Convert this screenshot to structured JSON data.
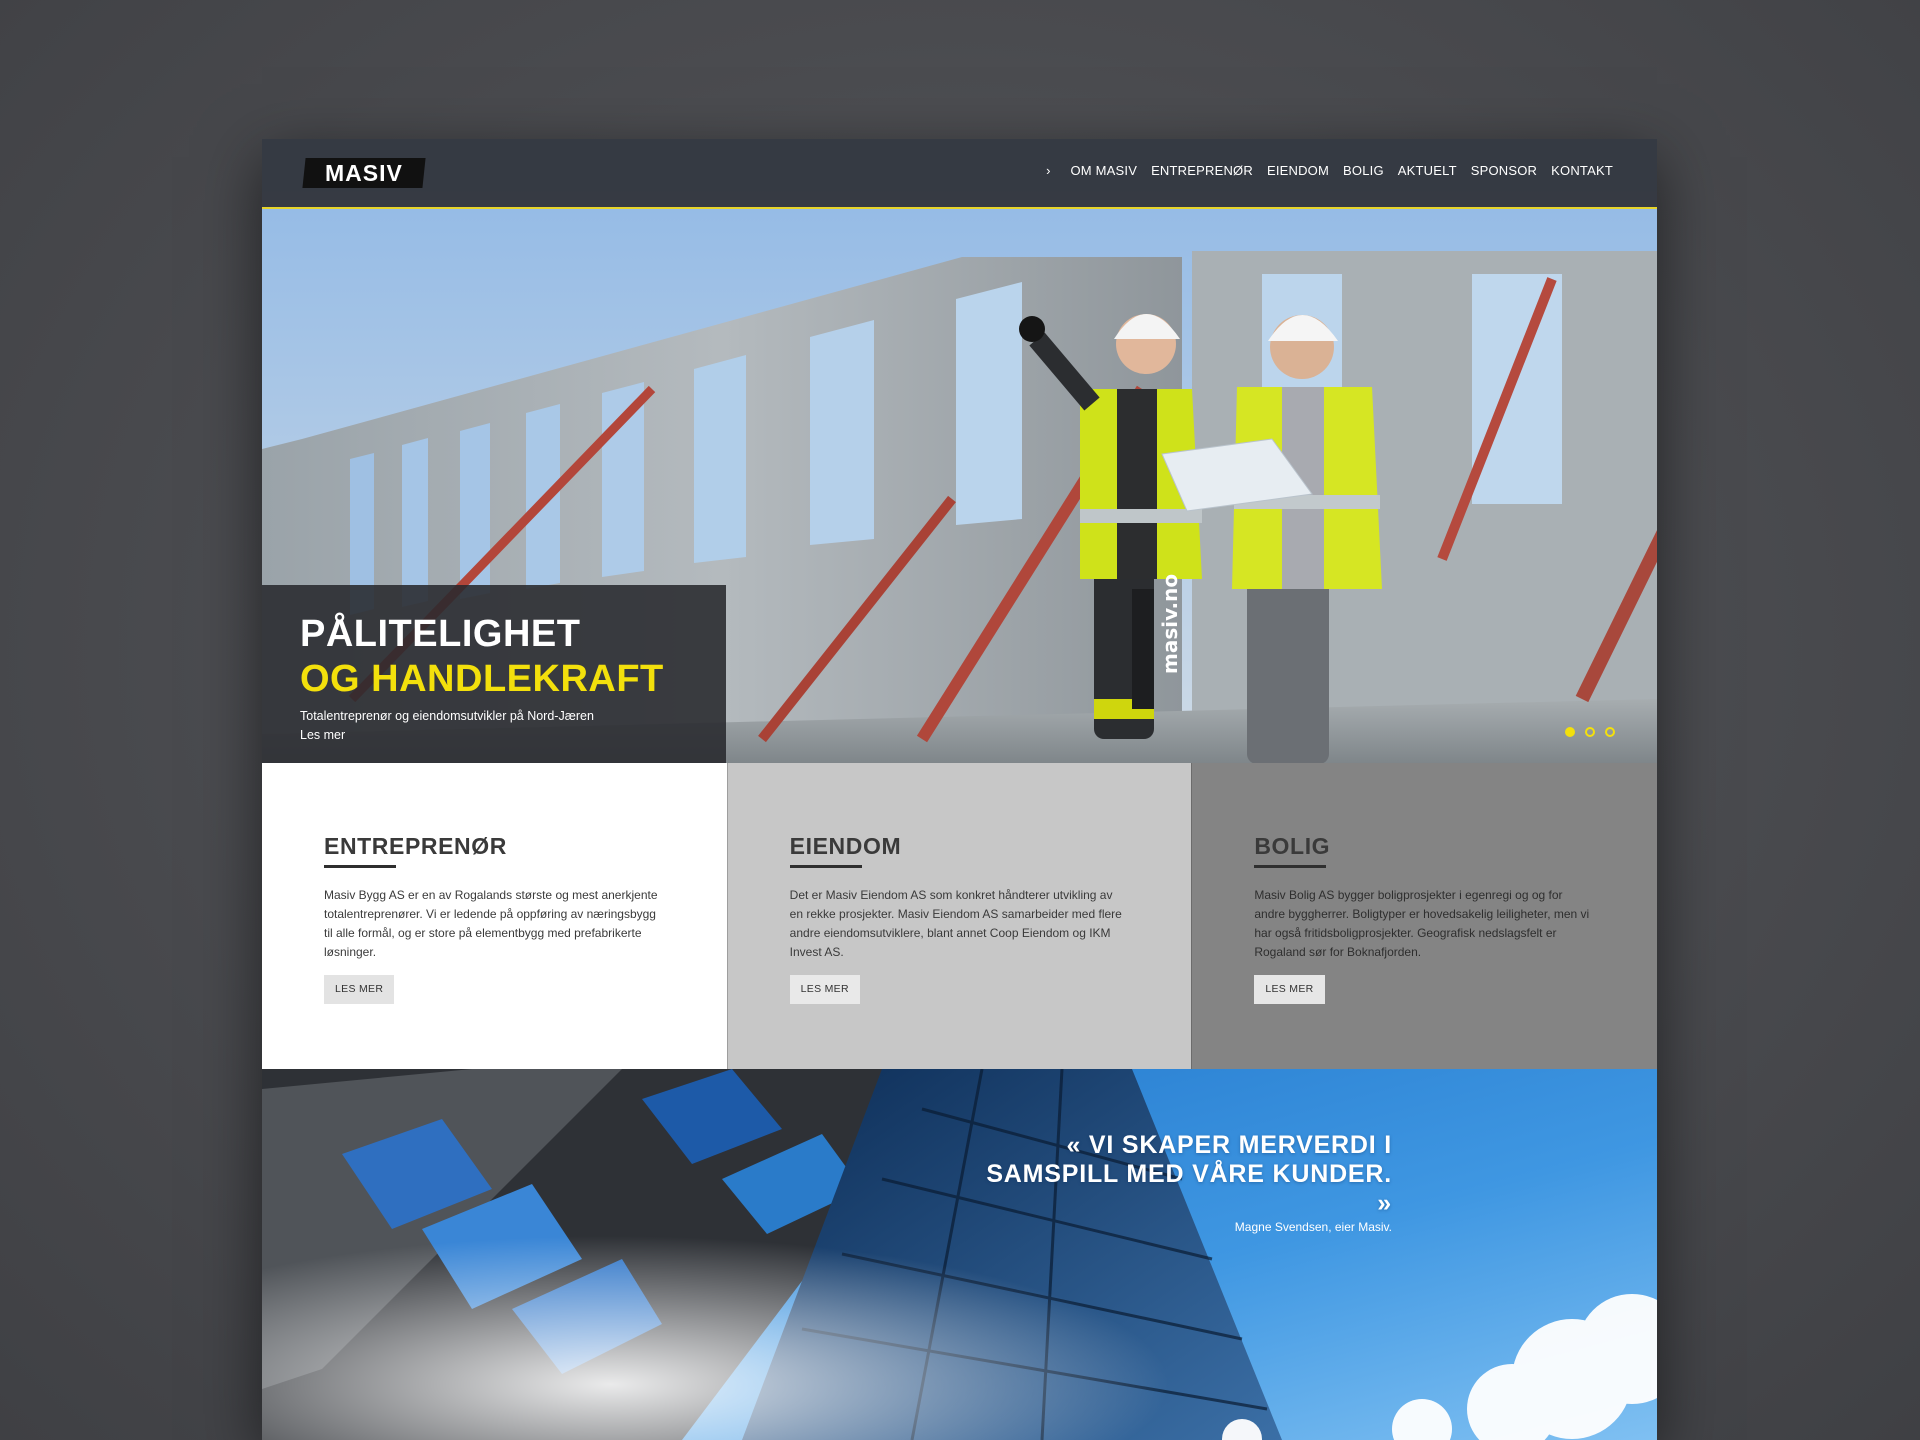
{
  "header": {
    "logo_text": "MASIV",
    "nav_arrow": "›",
    "nav": [
      "OM MASIV",
      "ENTREPRENØR",
      "EIENDOM",
      "BOLIG",
      "AKTUELT",
      "SPONSOR",
      "KONTAKT"
    ]
  },
  "hero": {
    "title_line1": "PÅLITELIGHET",
    "title_line2": "OG HANDLEKRAFT",
    "subtitle": "Totalentreprenør og eiendomsutvikler på Nord-Jæren",
    "link": "Les mer",
    "slides_total": 3,
    "active_slide": 1,
    "accent_color": "#f3e00c",
    "vest_marking": "masiv.no"
  },
  "services": [
    {
      "title": "ENTREPRENØR",
      "text": "Masiv Bygg AS er en av Rogalands største og mest anerkjente totalentreprenører. Vi er ledende på oppføring av næringsbygg til alle formål, og er store på elementbygg med prefabrikerte løsninger.",
      "button": "LES MER"
    },
    {
      "title": "EIENDOM",
      "text": "Det er Masiv Eiendom AS som konkret håndterer utvikling av en rekke prosjekter. Masiv Eiendom AS samarbeider med flere andre eiendomsutviklere, blant annet Coop Eiendom og IKM Invest AS.",
      "button": "LES MER"
    },
    {
      "title": "BOLIG",
      "text": "Masiv Bolig AS bygger boligprosjekter i egenregi og og for andre byggherrer. Boligtyper er hovedsakelig leiligheter, men vi har også fritidsboligprosjekter. Geografisk nedslagsfelt er Rogaland sør for Boknafjorden.",
      "button": "LES MER"
    }
  ],
  "quote": {
    "text": "« VI SKAPER MERVERDI I SAMSPILL MED VÅRE KUNDER. »",
    "author": "Magne Svendsen, eier Masiv."
  }
}
